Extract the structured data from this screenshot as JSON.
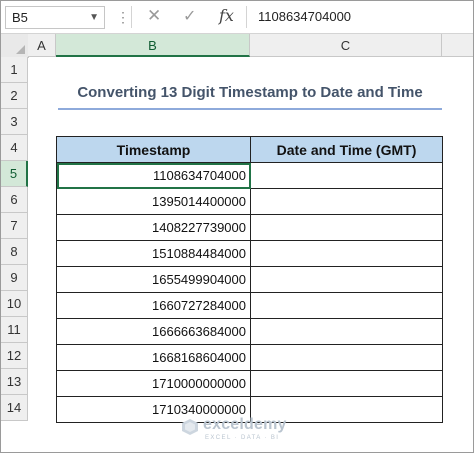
{
  "formula_bar": {
    "name_box": "B5",
    "formula": "1108634704000",
    "fx_label": "fx"
  },
  "columns": [
    "A",
    "B",
    "C"
  ],
  "rows": [
    "1",
    "2",
    "3",
    "4",
    "5",
    "6",
    "7",
    "8",
    "9",
    "10",
    "11",
    "12",
    "13",
    "14"
  ],
  "sheet": {
    "title": "Converting 13 Digit Timestamp to Date and Time",
    "headers": {
      "timestamp": "Timestamp",
      "datetime": "Date and Time (GMT)"
    },
    "timestamps": [
      "1108634704000",
      "1395014400000",
      "1408227739000",
      "1510884484000",
      "1655499904000",
      "1660727284000",
      "1666663684000",
      "1668168604000",
      "1710000000000",
      "1710340000000"
    ]
  },
  "watermark": {
    "name": "exceldemy",
    "tagline": "EXCEL · DATA · BI"
  },
  "colors": {
    "accent": "#217346",
    "header_fill": "#bdd7ee",
    "title": "#44546a"
  }
}
